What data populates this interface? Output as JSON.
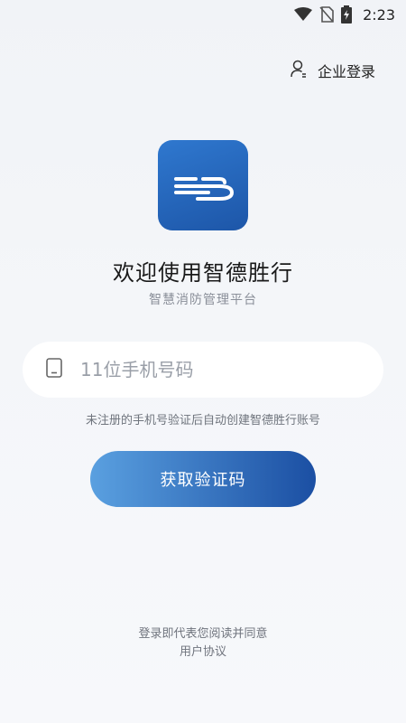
{
  "status_bar": {
    "time": "2:23",
    "icons": [
      "wifi-icon",
      "no-sim-icon",
      "battery-charging-icon"
    ]
  },
  "header": {
    "enterprise_login_label": "企业登录",
    "enterprise_login_icon": "user-icon"
  },
  "app": {
    "logo_icon": "app-logo-icon",
    "title": "欢迎使用智德胜行",
    "subtitle": "智慧消防管理平台"
  },
  "login_form": {
    "phone_placeholder": "11位手机号码",
    "phone_value": "",
    "phone_icon": "phone-icon",
    "hint": "未注册的手机号验证后自动创建智德胜行账号",
    "get_code_label": "获取验证码"
  },
  "footer": {
    "agreement_text": "登录即代表您阅读并同意",
    "agreement_link": "用户协议"
  },
  "colors": {
    "brand_blue": "#1d56a8",
    "button_gradient_start": "#5aa0e0",
    "button_gradient_end": "#1b4fa3"
  }
}
